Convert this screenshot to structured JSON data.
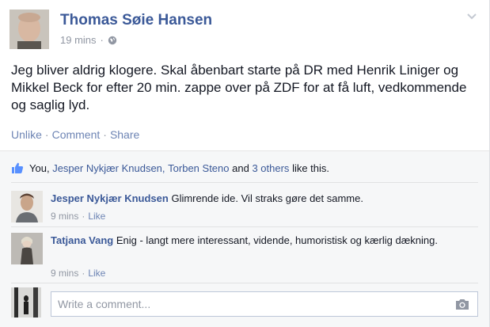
{
  "post": {
    "author": "Thomas Søie Hansen",
    "time": "19 mins",
    "privacy_icon": "globe-icon",
    "text": "Jeg bliver aldrig klogere. Skal åbenbart starte på DR med Henrik Liniger og Mikkel Beck for efter 20 min. zappe over på ZDF for at få luft, vedkommende og saglig lyd.",
    "actions": {
      "unlike": "Unlike",
      "comment": "Comment",
      "share": "Share"
    }
  },
  "likes": {
    "you": "You,",
    "person1": "Jesper Nykjær Knudsen,",
    "person2": "Torben Steno",
    "and": "and",
    "others": "3 others",
    "suffix": "like this."
  },
  "comments": [
    {
      "author": "Jesper Nykjær Knudsen",
      "text": "Glimrende ide. Vil straks gøre det samme.",
      "time": "9 mins",
      "like": "Like"
    },
    {
      "author": "Tatjana Vang",
      "text": "Enig - langt mere interessant, vidende, humoristisk og kærlig dækning.",
      "time": "9 mins",
      "like": "Like"
    }
  ],
  "composer": {
    "placeholder": "Write a comment...",
    "camera_icon": "camera-icon"
  },
  "colors": {
    "link": "#3b5998",
    "secondary": "#9197a3",
    "action": "#6d84b4",
    "ufi_bg": "#f6f7f8"
  }
}
